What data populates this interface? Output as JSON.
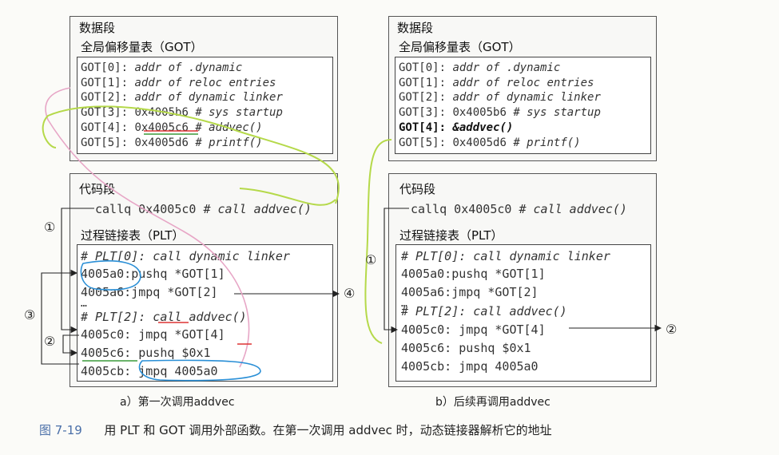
{
  "panel_a": {
    "data_title": "数据段",
    "got_title": "全局偏移量表（GOT）",
    "got_lines": [
      {
        "addr": "GOT[0]:",
        "rest": "addr of .dynamic"
      },
      {
        "addr": "GOT[1]:",
        "rest": "addr of reloc entries"
      },
      {
        "addr": "GOT[2]:",
        "rest": "addr of dynamic linker"
      },
      {
        "addr": "GOT[3]:",
        "val": "0x4005b6",
        "rest": "# sys startup"
      },
      {
        "addr": "GOT[4]:",
        "val": "0x4005c6",
        "rest": "# addvec()"
      },
      {
        "addr": "GOT[5]:",
        "val": "0x4005d6",
        "rest": "# printf()"
      }
    ],
    "code_title": "代码段",
    "callq": "callq 0x4005c0 #",
    "callq_comment": "call addvec()",
    "plt_title": "过程链接表（PLT）",
    "plt_lines": [
      {
        "text": "# PLT[0]: call dynamic linker",
        "italic": true
      },
      {
        "text": "4005a0:pushq *GOT[1]"
      },
      {
        "text": "4005a6:jmpq *GOT[2]"
      },
      {
        "text": "…"
      },
      {
        "text": "# PLT[2]: call addvec()",
        "italic": true
      },
      {
        "text": "4005c0: jmpq *GOT[4]"
      },
      {
        "text": "4005c6: pushq $0x1"
      },
      {
        "text": "4005cb: jmpq 4005a0"
      }
    ],
    "caption": "a）第一次调用addvec"
  },
  "panel_b": {
    "data_title": "数据段",
    "got_title": "全局偏移量表（GOT）",
    "got_lines": [
      {
        "addr": "GOT[0]:",
        "rest": "addr of .dynamic"
      },
      {
        "addr": "GOT[1]:",
        "rest": "addr of reloc entries"
      },
      {
        "addr": "GOT[2]:",
        "rest": "addr of dynamic linker"
      },
      {
        "addr": "GOT[3]:",
        "val": "0x4005b6",
        "rest": "# sys startup"
      },
      {
        "addr": "GOT[4]:",
        "val": "&addvec()",
        "rest": ""
      },
      {
        "addr": "GOT[5]:",
        "val": "0x4005d6",
        "rest": "# printf()"
      }
    ],
    "code_title": "代码段",
    "callq": "callq 0x4005c0 #",
    "callq_comment": "call addvec()",
    "plt_title": "过程链接表（PLT）",
    "plt_lines": [
      {
        "text": "# PLT[0]: call dynamic linker",
        "italic": true
      },
      {
        "text": "4005a0:pushq *GOT[1]"
      },
      {
        "text": "4005a6:jmpq  *GOT[2]"
      },
      {
        "text": "…"
      },
      {
        "text": "# PLT[2]: call addvec()",
        "italic": true
      },
      {
        "text": "4005c0: jmpq  *GOT[4]"
      },
      {
        "text": "4005c6: pushq $0x1"
      },
      {
        "text": "4005cb: jmpq  4005a0"
      }
    ],
    "caption": "b）后续再调用addvec"
  },
  "markers": {
    "m1": "①",
    "m2": "②",
    "m3": "③",
    "m4": "④"
  },
  "figure": {
    "number": "图 7-19",
    "caption": "用 PLT 和 GOT 调用外部函数。在第一次调用 addvec 时，动态链接器解析它的地址"
  }
}
